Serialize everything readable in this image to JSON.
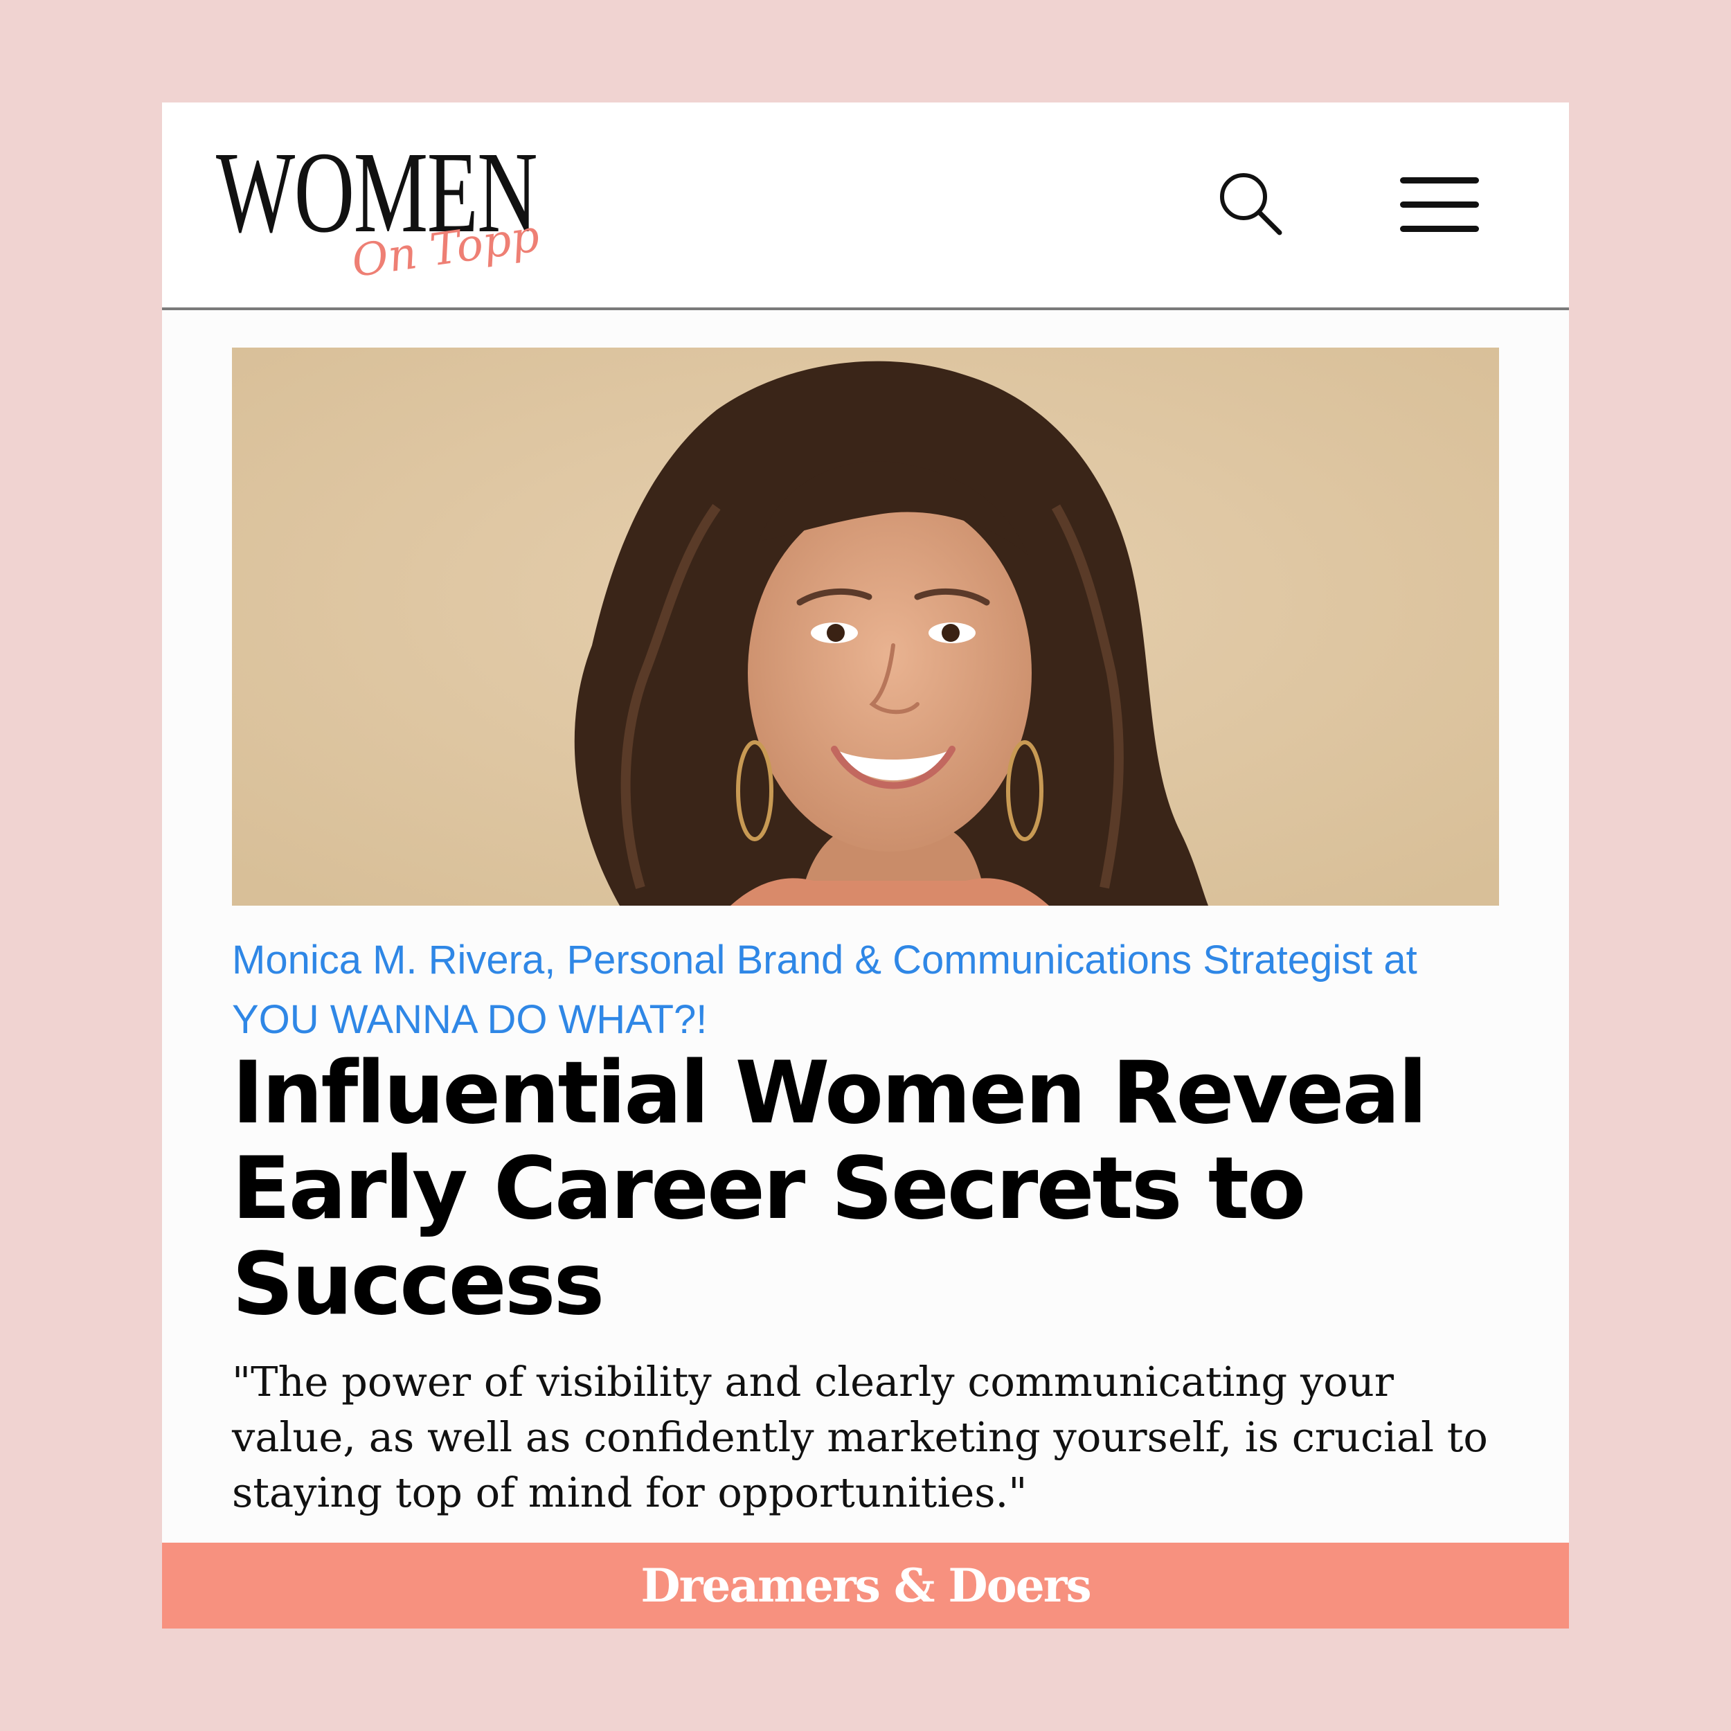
{
  "logo": {
    "main": "WOMEN",
    "sub": "On Topp"
  },
  "header": {
    "search_icon": "search-icon",
    "menu_icon": "hamburger-menu-icon"
  },
  "hero_image": {
    "subject": "Portrait photo of smiling woman with curly dark hair on beige background"
  },
  "article": {
    "byline": "Monica M. Rivera, Personal Brand & Communications Strategist at YOU WANNA DO WHAT?!",
    "title": "Influential Women Reveal Early Career Secrets to Success",
    "quote": "\"The power of visibility and clearly communicating your value, as well as confidently marketing yourself, is crucial to staying top of mind for opportunities.\""
  },
  "footer": {
    "label": "Dreamers & Doers"
  },
  "colors": {
    "page_background": "#f0d3d1",
    "byline": "#2f87e6",
    "logo_accent": "#ee7f74",
    "footer_band": "#f7917f"
  }
}
